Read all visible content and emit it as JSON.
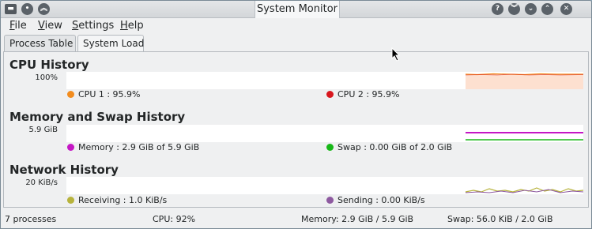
{
  "window": {
    "title": "System Monitor"
  },
  "titlebar_buttons": {
    "app_menu_icon": "window-menu-icon",
    "keep_below_icon": "dot-icon",
    "keep_above_icon": "double-chevron-up-icon",
    "help_icon": "question-icon",
    "shade_icon": "double-chevron-down-icon",
    "minimize_icon": "chevron-down-icon",
    "maximize_icon": "chevron-up-icon",
    "close_icon": "close-icon"
  },
  "menu": {
    "file": {
      "label": "File",
      "accel": "F",
      "rest": "ile"
    },
    "view": {
      "label": "View",
      "accel": "V",
      "rest": "iew"
    },
    "settings": {
      "label": "Settings",
      "accel": "S",
      "rest": "ettings"
    },
    "help": {
      "label": "Help",
      "accel": "H",
      "rest": "elp"
    }
  },
  "tabs": [
    {
      "label": "Process Table",
      "active": false
    },
    {
      "label": "System Load",
      "active": true
    }
  ],
  "cpu": {
    "title": "CPU History",
    "axis_max": "100%",
    "legend": [
      {
        "label": "CPU 1 : 95.9%",
        "color": "#f28c1e"
      },
      {
        "label": "CPU 2 : 95.9%",
        "color": "#d8171e"
      }
    ],
    "fill_color": "#fde0d0"
  },
  "memory": {
    "title": "Memory and Swap History",
    "axis_max": "5.9 GiB",
    "legend": [
      {
        "label": "Memory : 2.9 GiB of 5.9 GiB",
        "color": "#c417c4"
      },
      {
        "label": "Swap : 0.00 GiB of 2.0 GiB",
        "color": "#18b818"
      }
    ]
  },
  "network": {
    "title": "Network History",
    "axis_max": "20 KiB/s",
    "legend": [
      {
        "label": "Receiving : 1.0 KiB/s",
        "color": "#b7b33c"
      },
      {
        "label": "Sending : 0.00 KiB/s",
        "color": "#8e5aa0"
      }
    ]
  },
  "status": {
    "processes": "7 processes",
    "cpu": "CPU: 92%",
    "memory": "Memory: 2.9 GiB / 5.9 GiB",
    "swap": "Swap: 56.0 KiB / 2.0 GiB"
  }
}
